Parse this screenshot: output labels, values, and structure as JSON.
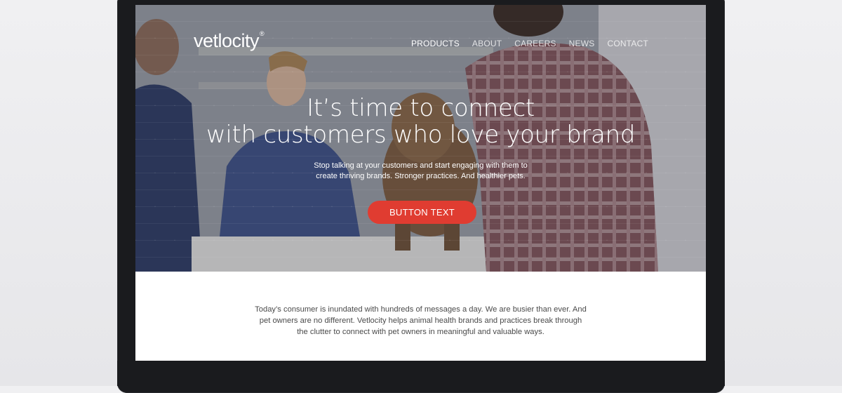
{
  "brand": {
    "name": "vetlocity",
    "registered_mark": "®"
  },
  "nav": {
    "items": [
      {
        "label": "PRODUCTS",
        "active": true
      },
      {
        "label": "ABOUT",
        "active": false
      },
      {
        "label": "CAREERS",
        "active": false
      },
      {
        "label": "NEWS",
        "active": false
      },
      {
        "label": "CONTACT",
        "active": false
      }
    ]
  },
  "hero": {
    "headline_lines": [
      "It’s time to connect",
      "with customers who love your brand"
    ],
    "subtext_lines": [
      "Stop talking at your customers and start engaging with them to",
      "create thriving brands. Stronger practices. And healthier pets."
    ],
    "button_label": "BUTTON TEXT"
  },
  "intro": {
    "lines": [
      "Today’s consumer is inundated with hundreds of messages a day. We are busier than ever. And",
      "pet owners are no different. Vetlocity helps animal health brands and practices break through",
      "the clutter to connect with pet owners in meaningful and valuable ways."
    ]
  },
  "colors": {
    "accent": "#e03c31",
    "text_dark": "#4a4a4a",
    "bezel": "#1a1b1e"
  }
}
